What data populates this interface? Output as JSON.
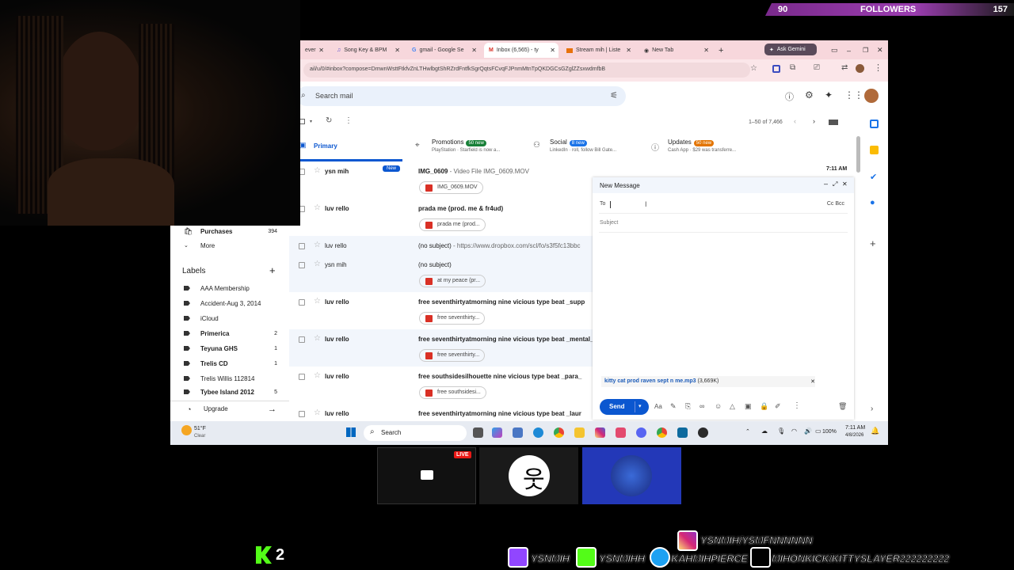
{
  "followers": {
    "count": "90",
    "label": "FOLLOWERS",
    "goal": "157"
  },
  "tabs": [
    {
      "label": "ever"
    },
    {
      "label": "Song Key & BPM"
    },
    {
      "label": "gmail - Google Se"
    },
    {
      "label": "Inbox (6,565) - ty"
    },
    {
      "label": "Stream mih | Liste"
    },
    {
      "label": "New Tab"
    }
  ],
  "ask_gemini": "Ask Gemini",
  "address": {
    "url": "ail/u/0/#inbox?compose=DmwnWsttFtkfvZnLTHwlbgtShRZrdFntfkSgrQqtsFCvqFJPnmMtnTpQKDGCsGZglZZsxwdmfbB"
  },
  "search": {
    "placeholder": "Search mail"
  },
  "pagination": "1–50 of 7,466",
  "categories": [
    {
      "label": "Primary"
    },
    {
      "label": "Promotions",
      "badge": "50 new",
      "snippet": "PlayStation · Starfield is now a..."
    },
    {
      "label": "Social",
      "badge": "8 new",
      "snippet": "LinkedIn · roll, follow Bill Gate..."
    },
    {
      "label": "Updates",
      "badge": "50 new",
      "snippet": "Cash App · $29 was transferre..."
    }
  ],
  "sidebar": {
    "purchases": {
      "label": "Purchases",
      "count": "394"
    },
    "more": "More",
    "labels_title": "Labels",
    "labels": [
      {
        "label": "AAA Membership",
        "count": ""
      },
      {
        "label": "Accident-Aug 3, 2014",
        "count": ""
      },
      {
        "label": "iCloud",
        "count": ""
      },
      {
        "label": "Primerica",
        "count": "2"
      },
      {
        "label": "Teyuna GHS",
        "count": "1"
      },
      {
        "label": "Trelis CD",
        "count": "1"
      },
      {
        "label": "Trelis Willis 112814",
        "count": ""
      },
      {
        "label": "Tybee Island 2012",
        "count": "5"
      }
    ],
    "upgrade": "Upgrade"
  },
  "emails": [
    {
      "sender": "ysn mih",
      "badge": "New",
      "subject": "IMG_0609",
      "snippet": " - Video File IMG_0609.MOV",
      "chip": "IMG_0609.MOV",
      "time": "7:11 AM"
    },
    {
      "sender": "luv rello",
      "subject": "prada me (prod. me & fr4ud)",
      "snippet": "",
      "chip": "prada me (prod..."
    },
    {
      "sender": "luv rello",
      "subject": "(no subject)",
      "snippet": " - https://www.dropbox.com/scl/fo/s3f5fc13bbc",
      "chip": ""
    },
    {
      "sender": "ysn mih",
      "subject": "(no subject)",
      "snippet": "",
      "chip": "at my peace (pr..."
    },
    {
      "sender": "luv rello",
      "subject": "free seventhirtyatmorning nine vicious type beat _supp",
      "snippet": "",
      "chip": "free seventhirty..."
    },
    {
      "sender": "luv rello",
      "subject": "free seventhirtyatmorning nine vicious type beat _mental_",
      "snippet": "",
      "chip": "free seventhirty..."
    },
    {
      "sender": "luv rello",
      "subject": "free southsidesilhouette nine vicious type beat _para_",
      "snippet": "",
      "chip": "free southsidesi..."
    },
    {
      "sender": "luv rello",
      "subject": "free seventhirtyatmorning nine vicious type beat _laur",
      "snippet": "",
      "chip": ""
    }
  ],
  "compose": {
    "title": "New Message",
    "to_label": "To",
    "ccbcc": "Cc Bcc",
    "subject_placeholder": "Subject",
    "attachment_name": "kitty cat prod raven sept n me.mp3",
    "attachment_size": "(3,669K)",
    "send": "Send"
  },
  "taskbar": {
    "weather_temp": "51°F",
    "weather_desc": "Clear",
    "search": "Search",
    "battery": "100%",
    "time": "7:11 AM",
    "date": "4/8/2026"
  },
  "overlay": {
    "live": "LIVE",
    "kick_count": "2",
    "instagram": "YSNMIH/YSMFNNNNNN",
    "twitch": "YSNMIH",
    "kick": "YSNMIHH",
    "twitter": "KAHMIHPIERCE",
    "tiktok": "MIHONKICK/KITTYSLAYER222222222"
  },
  "colors": {
    "promotions": "#188038",
    "social": "#1a73e8",
    "updates": "#e37400",
    "send": "#0b57d0",
    "follower_bar": "#9b3db0",
    "kick": "#53fc18"
  }
}
